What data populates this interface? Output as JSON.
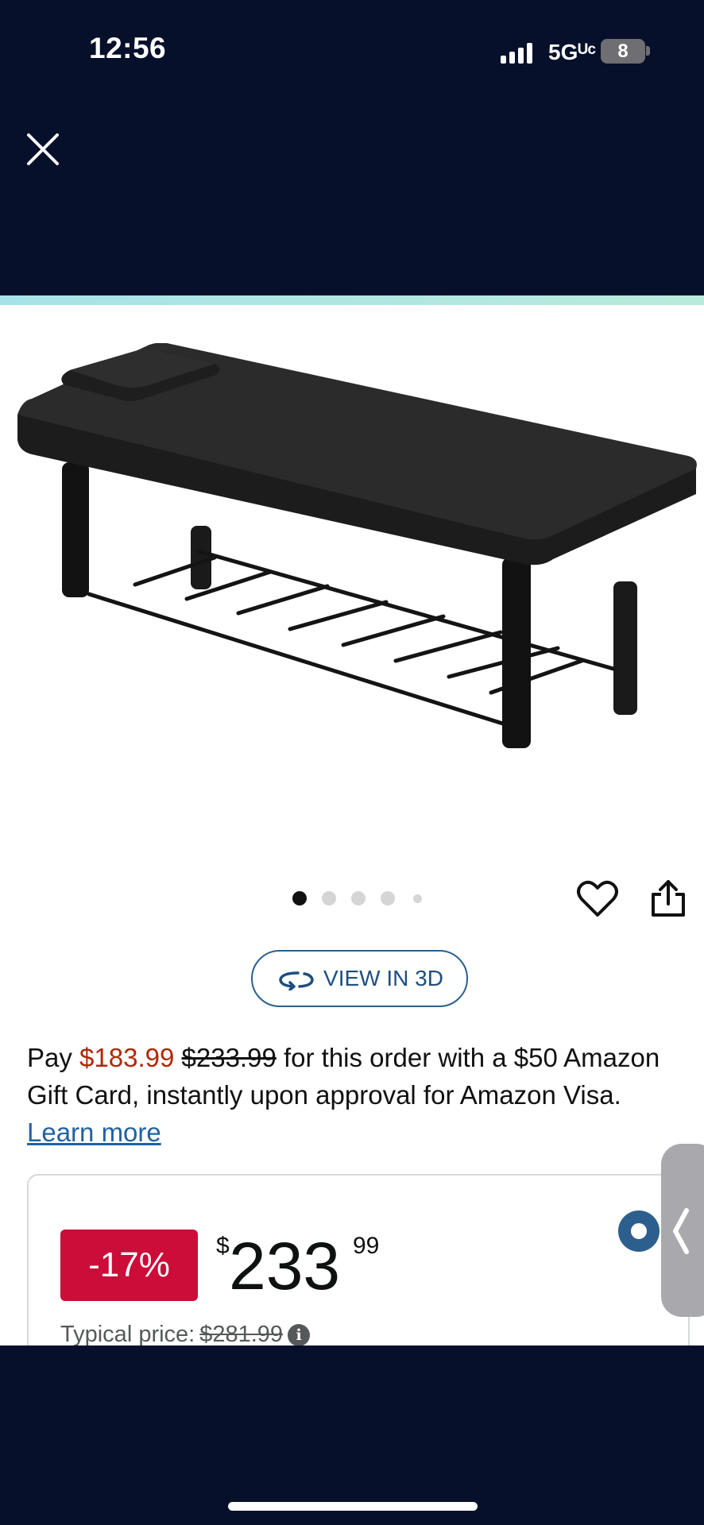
{
  "status_bar": {
    "time": "12:56",
    "network": "5Gᵁᶜ",
    "battery": "8"
  },
  "toolbar": {
    "close_icon": "close-icon"
  },
  "product": {
    "image_alt_icon": "product-image",
    "image_count": 5,
    "active_image": 1
  },
  "actions": {
    "favorite_icon": "heart-icon",
    "share_icon": "share-icon",
    "view3d_label": "VIEW IN 3D"
  },
  "promo": {
    "pay_prefix": "Pay ",
    "pay_price": "$183.99",
    "pay_old_price": "$233.99",
    "pay_suffix": " for this order with a $50 Amazon Gift Card, instantly upon approval for Amazon Visa. ",
    "learn_more": "Learn more"
  },
  "price": {
    "discount": "-17%",
    "currency": "$",
    "whole": "233",
    "fraction": "99",
    "typical_label": "Typical price: ",
    "typical_value": "$281.99"
  },
  "colors": {
    "background": "#06102a",
    "price_red": "#b12704",
    "discount_badge": "#cc0c39",
    "link_blue": "#2162a1"
  }
}
